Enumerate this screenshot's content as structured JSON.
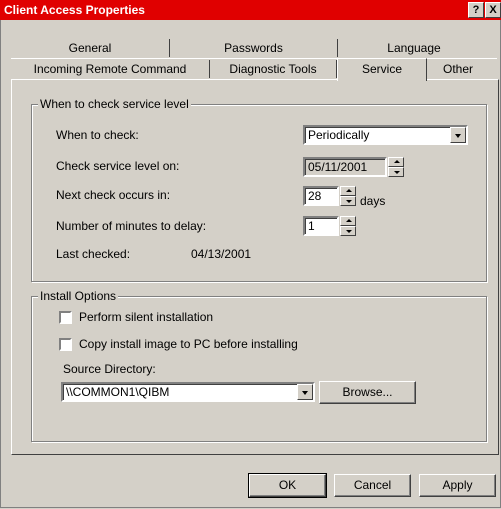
{
  "window": {
    "title": "Client Access Properties",
    "help_label": "?",
    "close_label": "X",
    "titlebar_color": "#e00000"
  },
  "tabs": {
    "row1": [
      "General",
      "Passwords",
      "Language"
    ],
    "row2": [
      "Incoming Remote Command",
      "Diagnostic Tools",
      "Service",
      "Other"
    ],
    "selected": "Service"
  },
  "service_group": {
    "title": "When to check service level",
    "when_to_check_label": "When to check:",
    "when_to_check_value": "Periodically",
    "check_on_label": "Check service level on:",
    "check_on_value": "05/11/2001",
    "next_check_label": "Next check occurs in:",
    "next_check_value": "28",
    "next_check_unit": "days",
    "delay_label": "Number of minutes to delay:",
    "delay_value": "1",
    "last_checked_label": "Last checked:",
    "last_checked_value": "04/13/2001"
  },
  "install_group": {
    "title": "Install Options",
    "silent_label": "Perform silent installation",
    "copy_label": "Copy install image to PC before installing",
    "source_dir_label": "Source Directory:",
    "source_dir_value": "\\\\COMMON1\\QIBM",
    "browse_label": "Browse..."
  },
  "footer": {
    "ok_label": "OK",
    "cancel_label": "Cancel",
    "apply_label": "Apply"
  }
}
